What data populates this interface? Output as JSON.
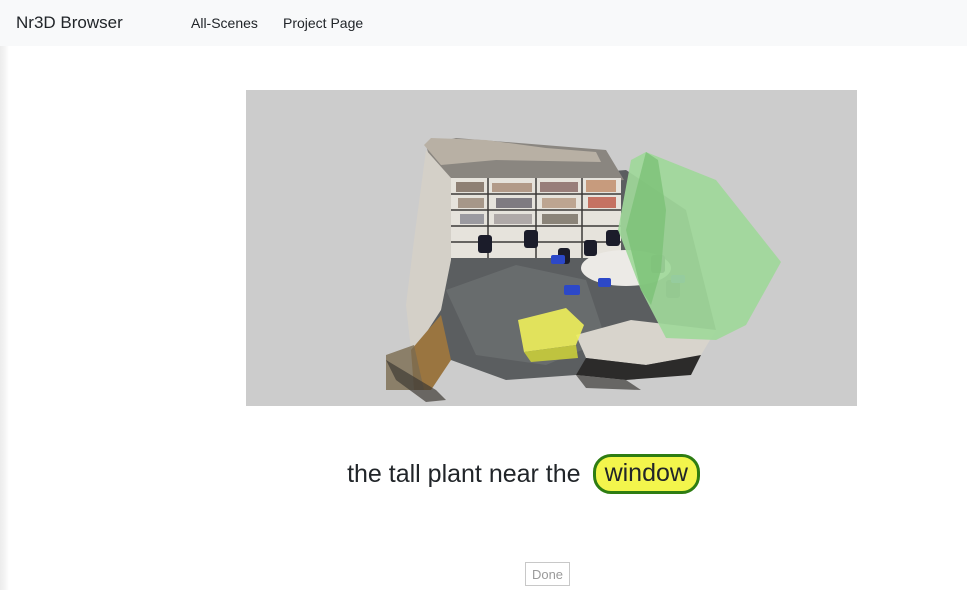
{
  "navbar": {
    "brand": "Nr3D Browser",
    "links": [
      "All-Scenes",
      "Project Page"
    ]
  },
  "scene": {
    "background_color": "#cccccc",
    "target_highlight_color": "#9fd89a",
    "distractor_highlight_color": "#eef05a"
  },
  "utterance": {
    "prefix": "the tall plant near the",
    "target_word": "window",
    "target_fill": "#f3f54c",
    "target_border": "#2e7d12"
  },
  "done_button": {
    "label": "Done"
  }
}
